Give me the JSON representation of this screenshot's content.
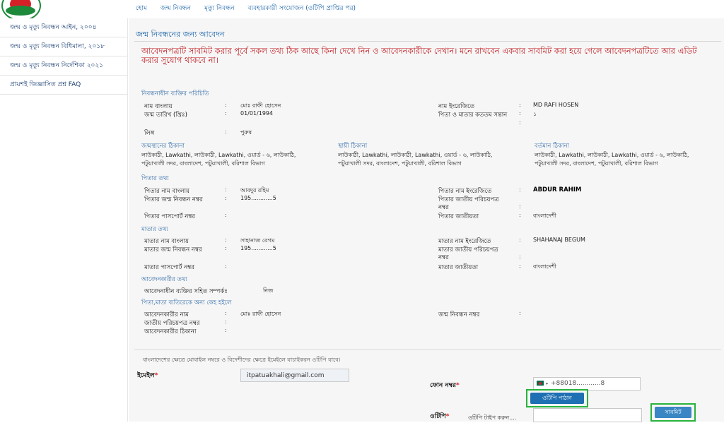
{
  "topnav": {
    "home": "হোম",
    "birth_reg": "জন্ম নিবন্ধন",
    "death_reg": "মৃত্যু নিবন্ধন",
    "user_link": "ব্যবহারকারী সংযোজন (ওটিপি প্রাপ্তির পর)"
  },
  "sidebar": {
    "items": [
      "জন্ম ও মৃত্যু নিবন্ধন আইন, ২০০৪",
      "জন্ম ও মৃত্যু নিবন্ধন বিধিমালা, ২০১৮",
      "জন্ম ও মৃত্যু নিবন্ধন নির্দেশিকা ২০২১",
      "প্রায়শই জিজ্ঞাসিত প্রশ্ন FAQ"
    ]
  },
  "page": {
    "title": "জন্ম নিবন্ধনের জন্য আবেদন",
    "warning": "আবেদনপত্রটি সাবমিট করার পূর্বে সকল তথ্য ঠিক আছে কিনা দেখে নিন ও আবেদনকারীকে দেখান। মনে রাখবেন একবার সাবমিট করা হয়ে গেলে আবেদনপত্রটিতে আর এডিট করার সুযোগ থাকবে না।"
  },
  "person": {
    "section": "নিবন্ধনাধীন ব্যক্তির পরিচিতি",
    "name_bn_label": "নাম বাংলায়",
    "name_bn": "মোঃ রাফী হোসেন",
    "name_en_label": "নাম ইংরেজিতে",
    "name_en": "MD RAFI HOSEN",
    "dob_label": "জন্ম তারিখ (খ্রিঃ)",
    "dob": "01/01/1994",
    "order_label": "পিতা ও মাতার কততম সন্তান",
    "order": "১",
    "gender_label": "লিঙ্গ",
    "gender": "পুরুষ"
  },
  "address": {
    "birth_label": "জন্মস্থানের ঠিকানা",
    "perm_label": "স্থায়ী ঠিকানা",
    "curr_label": "বর্তমান ঠিকানা",
    "text": "লাউকাঠী, Lawkathi, লাউকাঠী, Lawkathi, ওয়ার্ড - ৬, লাউকাঠি, পটুয়াখালী সদর, বাংলাদেশ, পটুয়াখালী, বরিশাল বিভাগ"
  },
  "father": {
    "section": "পিতার তথ্য",
    "name_bn_label": "পিতার নাম বাংলায়",
    "name_bn": "আবদুর রহিম",
    "name_en_label": "পিতার নাম ইংরেজিতে",
    "name_en": "ABDUR RAHIM",
    "brn_label": "পিতার জন্ম নিবন্ধন নম্বর",
    "brn": "195............5",
    "nid_label_1": "পিতার জাতীয় পরিচয়পত্র",
    "nid_label_2": "নম্বর",
    "passport_label": "পিতার পাসপোর্ট নম্বর",
    "nationality_label": "পিতার জাতীয়তা",
    "nationality": "বাংলাদেশী"
  },
  "mother": {
    "section": "মাতার তথ্য",
    "name_bn_label": "মাতার নাম বাংলায়",
    "name_bn": "সাহানাজ বেগম",
    "name_en_label": "মাতার নাম ইংরেজিতে",
    "name_en": "SHAHANAJ BEGUM",
    "brn_label": "মাতার জন্ম নিবন্ধন নম্বর",
    "brn": "195............5",
    "nid_label_1": "মাতার জাতীয় পরিচয়পত্র",
    "nid_label_2": "নম্বর",
    "passport_label": "মাতার পাসপোর্ট নম্বর",
    "nationality_label": "মাতার জাতীয়তা",
    "nationality": "বাংলাদেশী"
  },
  "applicant": {
    "section": "আবেদনকারীর তথ্য",
    "relation_label": "আবেদনাধীন ব্যক্তির সহিত সম্পর্কঃ",
    "relation": "নিজ",
    "other_section": "পিতা,মাতা ব্যতিরেকে অন্য কেহ হইলে",
    "name_label": "আবেদনকারীর নাম",
    "name": "মোঃ রাফী হোসেন",
    "brn_label": "জন্ম নিবন্ধন নম্বর",
    "nid_label": "জাতীয় পরিচয়পত্র নম্বর",
    "address_label": "আবেদনকারীর ঠিকানা"
  },
  "otp": {
    "note": "বাংলাদেশের ক্ষেত্রে মোবাইল নম্বরে ও বিদেশীদের ক্ষেত্রে ইমেইলে যাচাইকরন ওটিপি যাবে।",
    "email_label": "ইমেইল",
    "email": "itpatuakhali@gmail.com",
    "phone_label": "ফোন নম্বর",
    "phone": "+88018............8",
    "send_otp": "ওটিপি পাঠান",
    "otp_label": "ওটিপি",
    "otp_placeholder": "ওটিপি টাইপ করুন....",
    "submit": "সাবমিট",
    "required_mark": "*"
  },
  "colors": {
    "accent": "#1e70b3",
    "warning": "#c0161b",
    "highlight": "#28b33c"
  }
}
